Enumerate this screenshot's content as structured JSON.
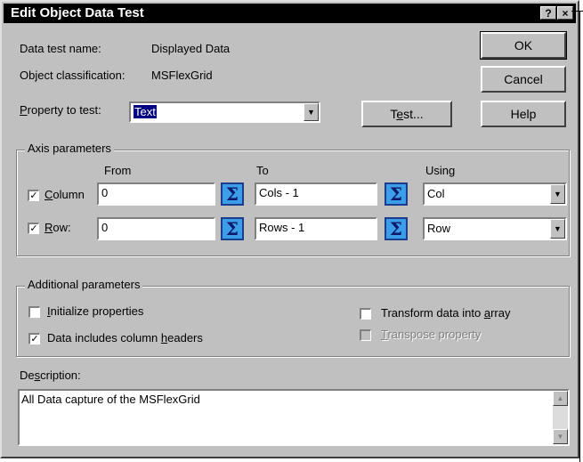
{
  "window": {
    "title": "Edit Object Data Test",
    "help_glyph": "?",
    "close_glyph": "×"
  },
  "info": {
    "test_name_label": "Data test name:",
    "test_name_value": "Displayed Data",
    "classification_label": "Object classification:",
    "classification_value": "MSFlexGrid"
  },
  "property": {
    "label_prefix": "P",
    "label_rest": "roperty to test:",
    "value": "Text"
  },
  "buttons": {
    "ok": "OK",
    "cancel": "Cancel",
    "help": "Help",
    "test_prefix": "T",
    "test_u": "e",
    "test_rest": "st..."
  },
  "axis": {
    "group_label": "Axis parameters",
    "from_header": "From",
    "to_header": "To",
    "using_header": "Using",
    "column": {
      "checked": true,
      "label_u": "C",
      "label_rest": "olumn",
      "from": "0",
      "to": "Cols - 1",
      "using": "Col"
    },
    "row": {
      "checked": true,
      "label_u": "R",
      "label_rest": "ow:",
      "from": "0",
      "to": "Rows - 1",
      "using": "Row"
    },
    "sigma_glyph": "Σ"
  },
  "additional": {
    "group_label": "Additional  parameters",
    "init_props": {
      "checked": false,
      "label_u": "I",
      "label_rest": "nitialize properties"
    },
    "col_headers": {
      "checked": true,
      "label_pre": "Data includes column ",
      "label_u": "h",
      "label_rest": "eaders"
    },
    "to_array": {
      "checked": false,
      "label_pre": "Transform data into ",
      "label_u": "a",
      "label_rest": "rray"
    },
    "transpose": {
      "checked": false,
      "disabled": true,
      "label_u": "T",
      "label_rest": "ranspose property"
    }
  },
  "description": {
    "label_pre": "De",
    "label_u": "s",
    "label_rest": "cription:",
    "text": "All Data capture of the MSFlexGrid"
  },
  "colors": {
    "sigma_bg": "#3c9ee8",
    "selection": "#000080",
    "dialog_bg": "#c0c0c0"
  }
}
